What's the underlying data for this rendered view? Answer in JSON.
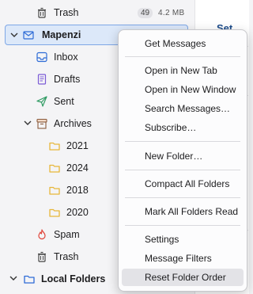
{
  "folders": {
    "trash_top": {
      "label": "Trash",
      "count": "49",
      "size": "4.2 MB"
    },
    "account": {
      "label": "Mapenzi"
    },
    "inbox": {
      "label": "Inbox"
    },
    "drafts": {
      "label": "Drafts"
    },
    "sent": {
      "label": "Sent"
    },
    "archives": {
      "label": "Archives"
    },
    "archive_years": [
      "2021",
      "2024",
      "2018",
      "2020"
    ],
    "spam": {
      "label": "Spam"
    },
    "trash": {
      "label": "Trash"
    },
    "local": {
      "label": "Local Folders"
    }
  },
  "main_fragment": {
    "heading": "Set Up"
  },
  "context_menu": {
    "items": [
      "Get Messages",
      "Open in New Tab",
      "Open in New Window",
      "Search Messages…",
      "Subscribe…",
      "New Folder…",
      "Compact All Folders",
      "Mark All Folders Read",
      "Settings",
      "Message Filters",
      "Reset Folder Order"
    ],
    "hovered": "Reset Folder Order"
  },
  "colors": {
    "accent": "#2d6bd6",
    "selection_bg": "#dce8f9",
    "folder_yellow": "#e7b73a",
    "spam_red": "#e0453a",
    "drafts_purple": "#7b5bd6",
    "sent_green": "#2f9b63"
  }
}
